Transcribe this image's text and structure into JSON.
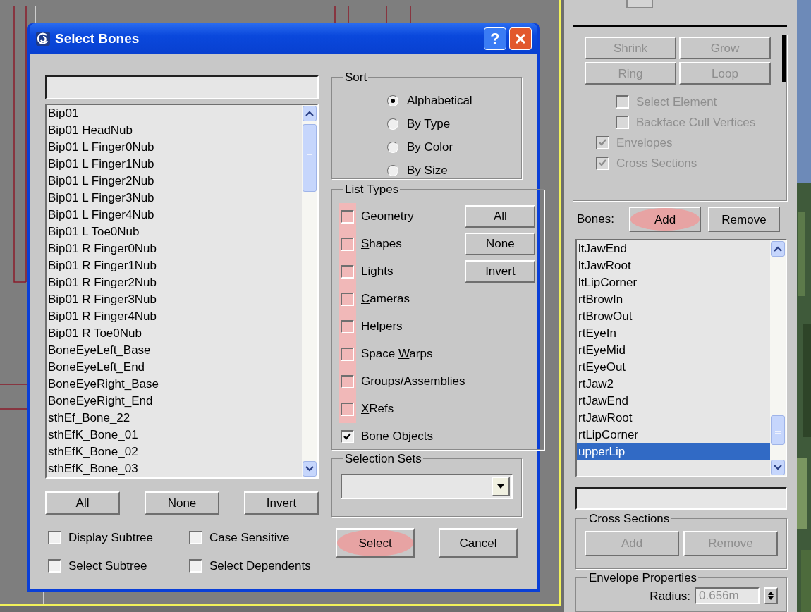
{
  "dialog": {
    "title": "Select Bones",
    "help": "?",
    "bones": [
      "Bip01",
      "Bip01 HeadNub",
      "Bip01 L Finger0Nub",
      "Bip01 L Finger1Nub",
      "Bip01 L Finger2Nub",
      "Bip01 L Finger3Nub",
      "Bip01 L Finger4Nub",
      "Bip01 L Toe0Nub",
      "Bip01 R Finger0Nub",
      "Bip01 R Finger1Nub",
      "Bip01 R Finger2Nub",
      "Bip01 R Finger3Nub",
      "Bip01 R Finger4Nub",
      "Bip01 R Toe0Nub",
      "BoneEyeLeft_Base",
      "BoneEyeLeft_End",
      "BoneEyeRight_Base",
      "BoneEyeRight_End",
      "sthEf_Bone_22",
      "sthEfK_Bone_01",
      "sthEfK_Bone_02",
      "sthEfK_Bone_03"
    ],
    "list_buttons": [
      {
        "key": "A",
        "after": "ll"
      },
      {
        "key": "N",
        "after": "one"
      },
      {
        "key": "I",
        "after": "nvert"
      }
    ],
    "options": [
      {
        "label": "Display Subtree",
        "checked": false
      },
      {
        "label": "Case Sensitive",
        "checked": false
      },
      {
        "label": "Select Subtree",
        "checked": false
      },
      {
        "label": "Select Dependents",
        "checked": false
      }
    ],
    "sort": {
      "title": "Sort",
      "options": [
        {
          "label": "Alphabetical",
          "selected": true
        },
        {
          "label": "By Type",
          "selected": false
        },
        {
          "label": "By Color",
          "selected": false
        },
        {
          "label": "By Size",
          "selected": false
        }
      ]
    },
    "list_types": {
      "title": "List Types",
      "items": [
        {
          "label": {
            "key": "G",
            "after": "eometry"
          },
          "checked": false,
          "highlighted": true
        },
        {
          "label": {
            "key": "S",
            "after": "hapes"
          },
          "checked": false,
          "highlighted": true
        },
        {
          "label": {
            "key": "L",
            "after": "ights"
          },
          "checked": false,
          "highlighted": true
        },
        {
          "label": {
            "key": "C",
            "after": "ameras"
          },
          "checked": false,
          "highlighted": true
        },
        {
          "label": {
            "key": "H",
            "after": "elpers"
          },
          "checked": false,
          "highlighted": true
        },
        {
          "label": {
            "before": "Space ",
            "key": "W",
            "after": "arps"
          },
          "checked": false,
          "highlighted": true
        },
        {
          "label": {
            "before": "Grou",
            "key": "p",
            "after": "s/Assemblies"
          },
          "checked": false,
          "highlighted": true
        },
        {
          "label": {
            "key": "X",
            "after": "Refs"
          },
          "checked": false,
          "highlighted": true
        },
        {
          "label": {
            "key": "B",
            "after": "one Objects"
          },
          "checked": true,
          "highlighted": false
        }
      ],
      "buttons": [
        "All",
        "None",
        "Invert"
      ]
    },
    "selection_sets": {
      "title": "Selection Sets"
    },
    "actions": [
      {
        "label": "Select",
        "highlighted": true
      },
      {
        "label": "Cancel",
        "highlighted": false
      }
    ]
  },
  "panel": {
    "selection_buttons": [
      {
        "label": "Shrink",
        "disabled": true
      },
      {
        "label": "Grow",
        "disabled": true
      },
      {
        "label": "Ring",
        "disabled": true
      },
      {
        "label": "Loop",
        "disabled": true
      }
    ],
    "element_options": [
      {
        "label": "Select Element",
        "checked": false,
        "disabled": true
      },
      {
        "label": "Backface Cull Vertices",
        "checked": false,
        "disabled": true
      }
    ],
    "display_options": [
      {
        "label": "Envelopes",
        "checked": true,
        "disabled": true
      },
      {
        "label": "Cross Sections",
        "checked": true,
        "disabled": true
      }
    ],
    "bones_label": "Bones:",
    "bone_buttons": [
      {
        "label": "Add",
        "highlighted": true
      },
      {
        "label": "Remove",
        "highlighted": false
      }
    ],
    "bones": [
      {
        "name": "ltJawEnd",
        "selected": false
      },
      {
        "name": "ltJawRoot",
        "selected": false
      },
      {
        "name": "ltLipCorner",
        "selected": false
      },
      {
        "name": "rtBrowIn",
        "selected": false
      },
      {
        "name": "rtBrowOut",
        "selected": false
      },
      {
        "name": "rtEyeIn",
        "selected": false
      },
      {
        "name": "rtEyeMid",
        "selected": false
      },
      {
        "name": "rtEyeOut",
        "selected": false
      },
      {
        "name": "rtJaw2",
        "selected": false
      },
      {
        "name": "rtJawEnd",
        "selected": false
      },
      {
        "name": "rtJawRoot",
        "selected": false
      },
      {
        "name": "rtLipCorner",
        "selected": false
      },
      {
        "name": "upperLip",
        "selected": true
      }
    ],
    "cross_sections": {
      "title": "Cross Sections",
      "buttons": [
        {
          "label": "Add",
          "disabled": true
        },
        {
          "label": "Remove",
          "disabled": true
        }
      ]
    },
    "envelope_properties": {
      "title": "Envelope Properties",
      "radius_label": "Radius:",
      "radius_value": "0.656m"
    }
  }
}
